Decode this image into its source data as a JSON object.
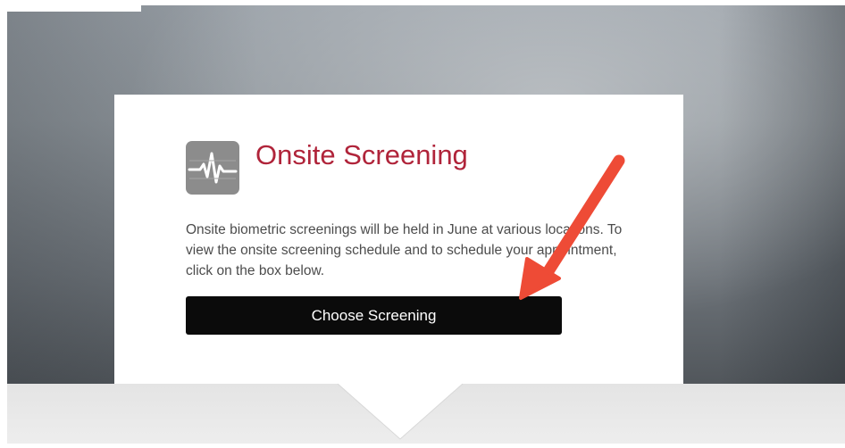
{
  "card": {
    "title": "Onsite Screening",
    "icon": "heartbeat-icon",
    "description": "Onsite biometric screenings will be held in June at various locations. To view the onsite screening schedule and to schedule your appointment, click on the box below.",
    "button_label": "Choose Screening"
  },
  "annotation": {
    "arrow_color": "#ee4b36",
    "arrow": "red-arrow-annotation"
  },
  "colors": {
    "title": "#b0243a",
    "button_bg": "#0b0b0b",
    "icon_bg": "#8c8c8c"
  }
}
